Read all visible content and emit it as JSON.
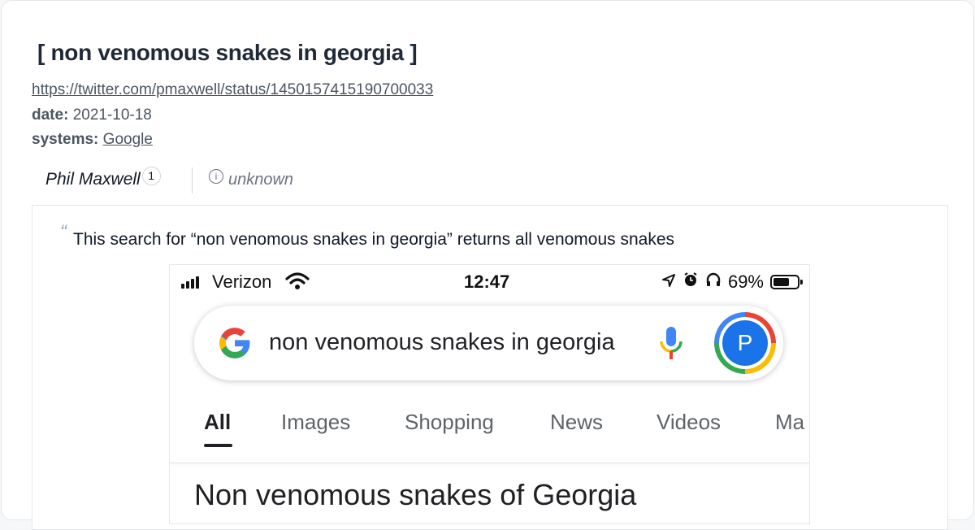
{
  "page": {
    "title": "[ non venomous snakes in georgia ]",
    "url": "https://twitter.com/pmaxwell/status/1450157415190700033",
    "date_label": "date:",
    "date_value": "2021-10-18",
    "systems_label": "systems:",
    "systems_value": "Google"
  },
  "attribution": {
    "author": "Phil Maxwell",
    "footnote": "1",
    "info_icon": "i",
    "status": "unknown"
  },
  "quote": {
    "mark": "“",
    "text": "This search for “non venomous snakes in georgia” returns all venomous snakes"
  },
  "screenshot": {
    "carrier": "Verizon",
    "time": "12:47",
    "battery": "69%",
    "battery_level": 0.69,
    "query": "non venomous snakes in georgia",
    "avatar_letter": "P",
    "tabs": [
      "All",
      "Images",
      "Shopping",
      "News",
      "Videos",
      "Ma"
    ],
    "active_tab": "All",
    "result_title": "Non venomous snakes of Georgia",
    "icons": [
      "signal-icon",
      "wifi-icon",
      "location-icon",
      "alarm-icon",
      "headphones-icon",
      "battery-icon",
      "google-logo-icon",
      "microphone-icon"
    ]
  },
  "colors": {
    "google_blue": "#4285f4",
    "google_red": "#ea4335",
    "google_yellow": "#fbbc05",
    "google_green": "#34a853",
    "avatar_blue": "#1a73e8"
  }
}
